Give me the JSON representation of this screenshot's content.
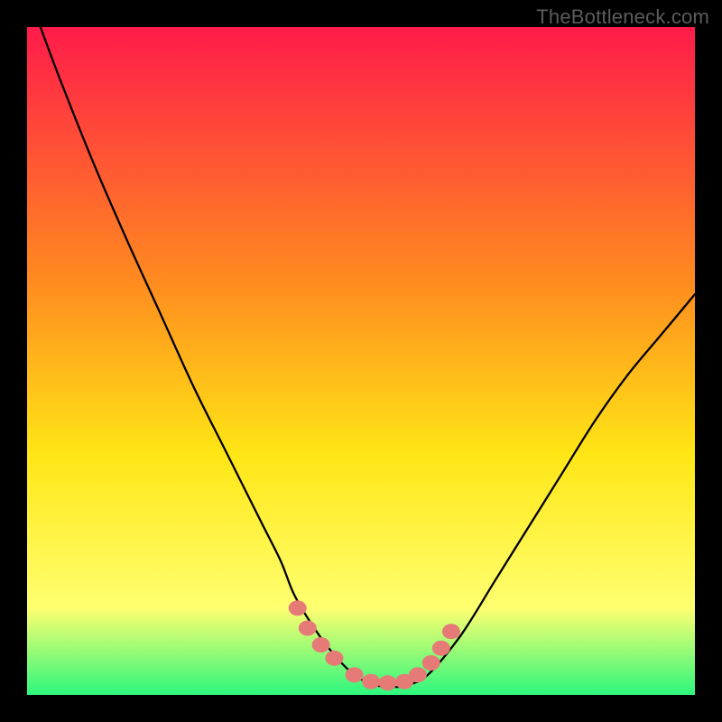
{
  "watermark": "TheBottleneck.com",
  "chart_data": {
    "type": "line",
    "title": "",
    "xlabel": "",
    "ylabel": "",
    "xlim": [
      0,
      100
    ],
    "ylim": [
      0,
      100
    ],
    "grid": false,
    "series": [
      {
        "name": "curve",
        "x": [
          2,
          5,
          10,
          15,
          20,
          25,
          30,
          35,
          38,
          40,
          43,
          46,
          49,
          52,
          55,
          57,
          60,
          65,
          70,
          75,
          80,
          85,
          90,
          95,
          100
        ],
        "values": [
          100,
          92,
          79.5,
          68,
          57,
          46,
          36,
          26,
          20,
          15,
          10,
          6,
          3,
          1.5,
          1.2,
          1.5,
          3,
          9,
          17,
          25,
          33,
          41,
          48,
          54,
          60
        ]
      }
    ],
    "markers": {
      "name": "bottom-markers",
      "x": [
        40.5,
        42.0,
        44.0,
        46.0,
        49.0,
        51.5,
        54.0,
        56.5,
        58.5,
        60.5,
        62.0,
        63.5
      ],
      "values": [
        13.0,
        10.0,
        7.5,
        5.5,
        3.0,
        2.0,
        1.8,
        2.0,
        3.0,
        4.8,
        7.0,
        9.5
      ]
    },
    "background_gradient": {
      "top": "#ff1b4a",
      "mid1": "#ff8b1f",
      "mid2": "#ffe615",
      "mid3": "#ffff70",
      "bottom": "#2cf77d"
    }
  }
}
